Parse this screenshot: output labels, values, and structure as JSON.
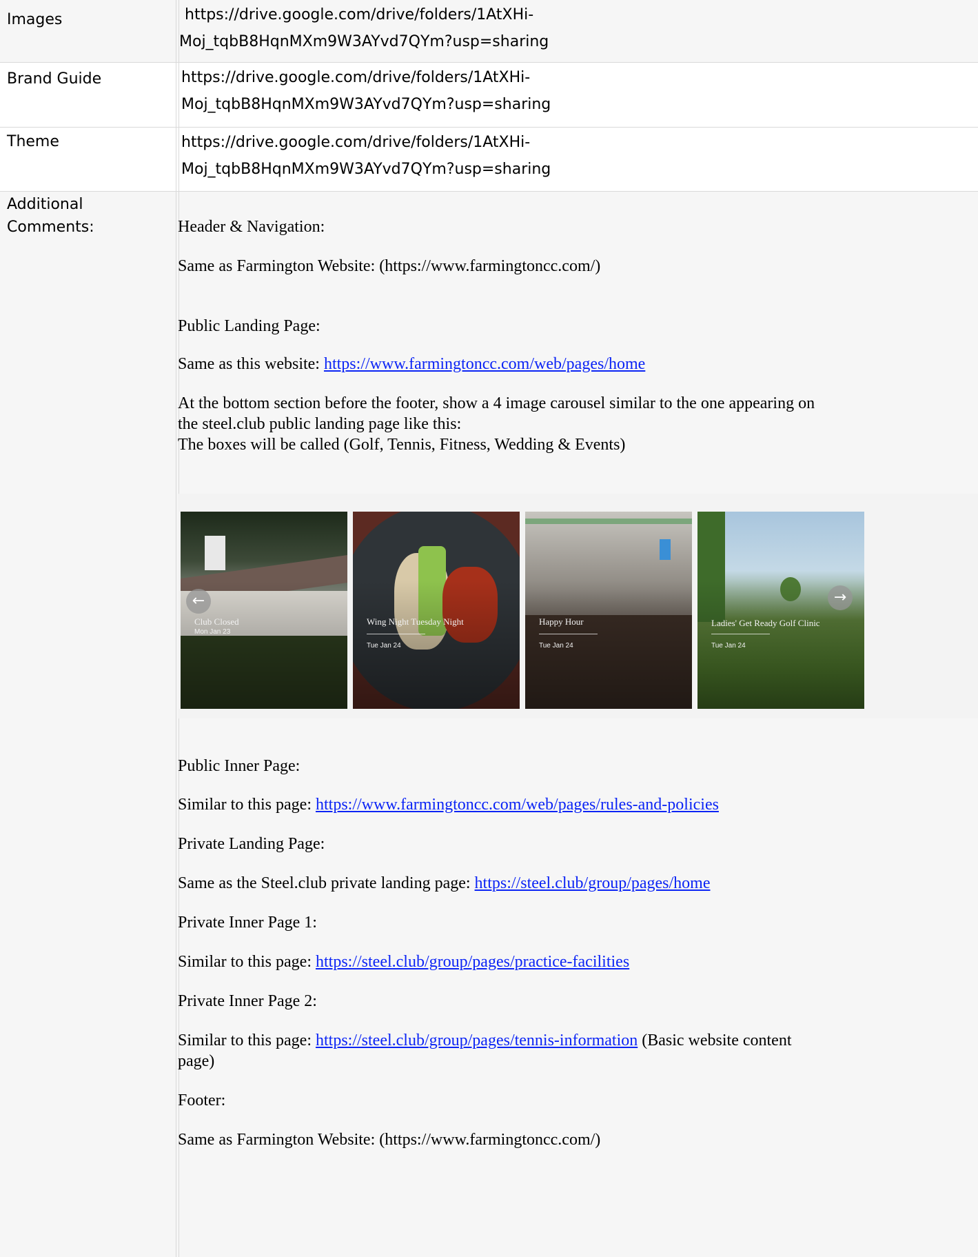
{
  "rows": [
    {
      "label": "Images",
      "value_line1": "https://drive.google.com/drive/folders/1AtXHi-",
      "value_line2": "Moj_tqbB8HqnMXm9W3AYvd7QYm?usp=sharing"
    },
    {
      "label": "Brand Guide",
      "value_line1": "https://drive.google.com/drive/folders/1AtXHi-",
      "value_line2": "Moj_tqbB8HqnMXm9W3AYvd7QYm?usp=sharing"
    },
    {
      "label": "Theme",
      "value_line1": "https://drive.google.com/drive/folders/1AtXHi-",
      "value_line2": "Moj_tqbB8HqnMXm9W3AYvd7QYm?usp=sharing"
    }
  ],
  "comments": {
    "label_line1": "Additional",
    "label_line2": "Comments:",
    "header_nav_heading": "Header & Navigation:",
    "header_nav_text": "Same as Farmington Website: (https://www.farmingtoncc.com/)",
    "public_landing_heading": "Public Landing Page:",
    "public_landing_prefix": "Same as this website: ",
    "public_landing_link": "https://www.farmingtoncc.com/web/pages/home",
    "carousel_intro_1": "At the bottom section before the footer, show a 4 image carousel similar to the one appearing on",
    "carousel_intro_2": "the steel.club public landing page like this:",
    "carousel_intro_3": "The boxes will be called (Golf, Tennis, Fitness, Wedding & Events)",
    "public_inner_heading": "Public Inner Page:",
    "public_inner_prefix": "Similar to this page: ",
    "public_inner_link": "https://www.farmingtoncc.com/web/pages/rules-and-policies",
    "private_landing_heading": "Private Landing Page:",
    "private_landing_prefix": "Same as the Steel.club private landing page: ",
    "private_landing_link": "https://steel.club/group/pages/home",
    "private_inner1_heading": "Private Inner Page 1:",
    "private_inner1_prefix": "Similar to this page: ",
    "private_inner1_link": "https://steel.club/group/pages/practice-facilities",
    "private_inner2_heading": "Private Inner Page 2:",
    "private_inner2_prefix": "Similar to this page: ",
    "private_inner2_link": "https://steel.club/group/pages/tennis-information",
    "private_inner2_suffix_1": "  (Basic website content",
    "private_inner2_suffix_2": "page)",
    "footer_heading": "Footer:",
    "footer_text": "Same as Farmington Website: (https://www.farmingtoncc.com/)"
  },
  "carousel": {
    "cards": [
      {
        "title": "Club Closed",
        "date": "Mon Jan 23",
        "icon": "clubhouse-photo"
      },
      {
        "title": "Wing Night Tuesday Night",
        "date": "Tue Jan 24",
        "icon": "wings-photo"
      },
      {
        "title": "Happy Hour",
        "date": "Tue Jan 24",
        "icon": "bar-crowd-photo"
      },
      {
        "title": "Ladies' Get Ready Golf Clinic",
        "date": "Tue Jan 24",
        "icon": "golf-course-photo"
      }
    ],
    "prev_arrow": "←",
    "next_arrow": "→"
  }
}
